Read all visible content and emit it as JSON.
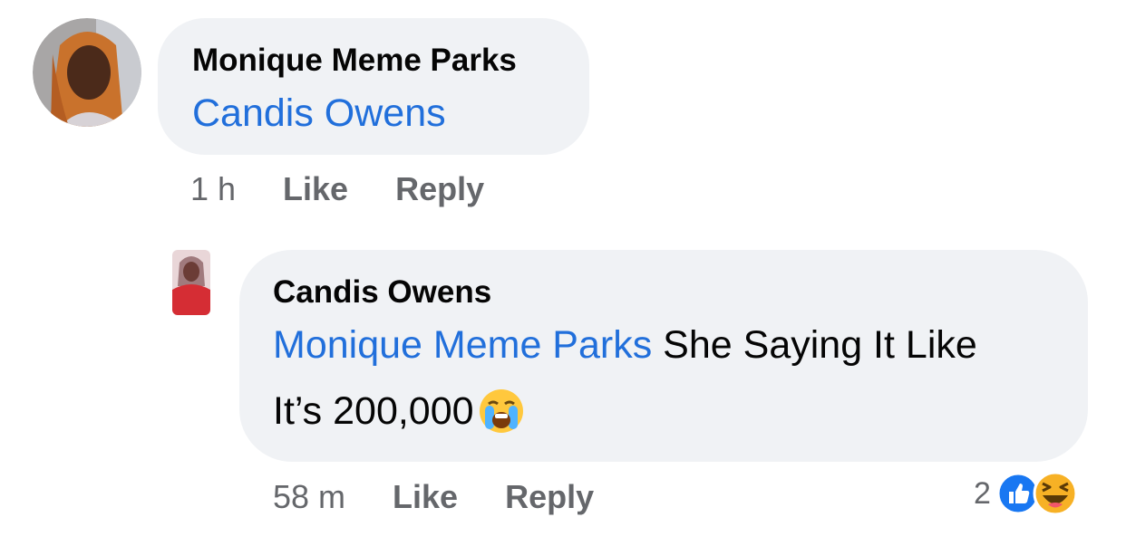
{
  "comment": {
    "author": "Monique Meme Parks",
    "body_mention": "Candis Owens",
    "time": "1 h",
    "like_label": "Like",
    "reply_label": "Reply"
  },
  "reply": {
    "author": "Candis Owens",
    "body_mention": "Monique Meme Parks",
    "body_line1": " She Saying It Like",
    "body_line2": "It’s 200,000",
    "body_emoji": "loudly-crying-face",
    "time": "58 m",
    "like_label": "Like",
    "reply_label": "Reply",
    "reaction_count": "2",
    "reaction_icons": [
      "like-icon",
      "haha-icon"
    ]
  },
  "colors": {
    "bubble": "#f0f2f5",
    "mention": "#216fdb",
    "meta": "#65676b",
    "like_blue": "#1877f2",
    "haha_yellow": "#f7b125"
  }
}
